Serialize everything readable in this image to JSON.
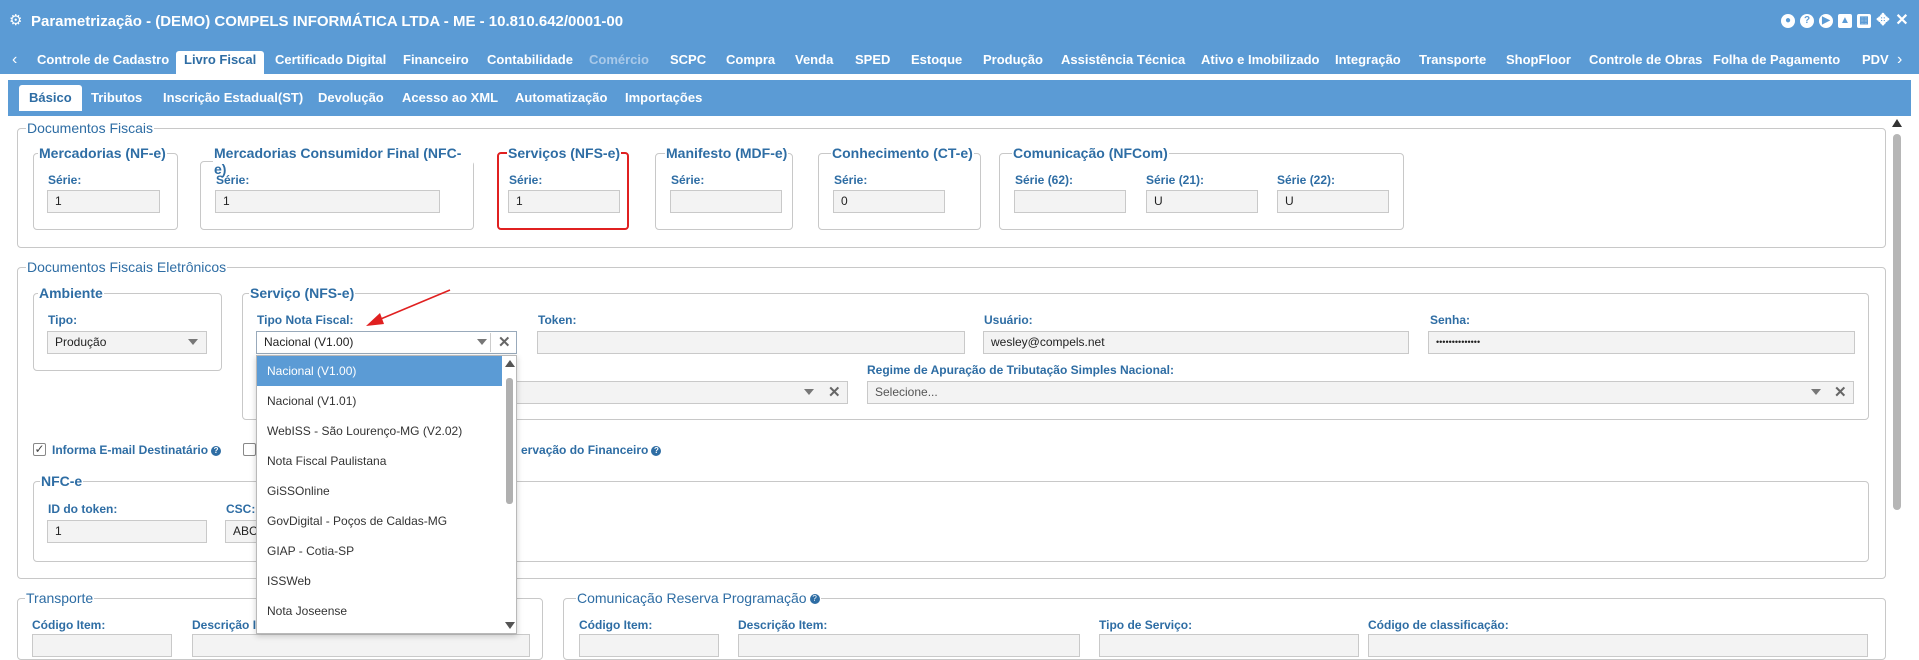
{
  "window": {
    "title": "Parametrização - (DEMO) COMPELS INFORMÁTICA LTDA - ME - 10.810.642/0001-00"
  },
  "main_tabs": [
    "Controle de Cadastro",
    "Livro Fiscal",
    "Certificado Digital",
    "Financeiro",
    "Contabilidade",
    "Comércio",
    "SCPC",
    "Compra",
    "Venda",
    "SPED",
    "Estoque",
    "Produção",
    "Assistência Técnica",
    "Ativo e Imobilizado",
    "Integração",
    "Transporte",
    "ShopFloor",
    "Controle de Obras",
    "Folha de Pagamento",
    "PDV"
  ],
  "sub_tabs": [
    "Básico",
    "Tributos",
    "Inscrição Estadual(ST)",
    "Devolução",
    "Acesso ao XML",
    "Automatização",
    "Importações"
  ],
  "docs_fiscais": {
    "legend": "Documentos Fiscais",
    "mercadorias": {
      "legend": "Mercadorias (NF-e)",
      "serie_label": "Série:",
      "serie": "1"
    },
    "consumidor": {
      "legend": "Mercadorias Consumidor Final (NFC-e)",
      "serie_label": "Série:",
      "serie": "1"
    },
    "servicos": {
      "legend": "Serviços (NFS-e)",
      "serie_label": "Série:",
      "serie": "1"
    },
    "manifesto": {
      "legend": "Manifesto (MDF-e)",
      "serie_label": "Série:",
      "serie": ""
    },
    "conhecimento": {
      "legend": "Conhecimento (CT-e)",
      "serie_label": "Série:",
      "serie": "0"
    },
    "comunicacao": {
      "legend": "Comunicação (NFCom)",
      "s62_label": "Série (62):",
      "s62": "",
      "s21_label": "Série (21):",
      "s21": "U",
      "s22_label": "Série (22):",
      "s22": "U"
    }
  },
  "docs_eletronicos": {
    "legend": "Documentos Fiscais Eletrônicos",
    "ambiente": {
      "legend": "Ambiente",
      "tipo_label": "Tipo:",
      "tipo": "Produção"
    },
    "servico": {
      "legend": "Serviço (NFS-e)",
      "tipo_nota_label": "Tipo Nota Fiscal:",
      "tipo_nota": "Nacional (V1.00)",
      "token_label": "Token:",
      "token": "",
      "usuario_label": "Usuário:",
      "usuario": "wesley@compels.net",
      "senha_label": "Senha:",
      "senha": "••••••••••••••",
      "regime_label": "Regime de Apuração de Tributação Simples Nacional:",
      "regime_placeholder": "Selecione..."
    },
    "informa_email": "Informa E-mail Destinatário",
    "observacao_fin": "ervação do Financeiro",
    "nfce": {
      "legend": "NFC-e",
      "id_token_label": "ID do token:",
      "id_token": "1",
      "csc_label": "CSC:",
      "csc": "ABC"
    }
  },
  "dropdown": {
    "options": [
      "Nacional (V1.00)",
      "Nacional (V1.01)",
      "WebISS - São Lourenço-MG (V2.02)",
      "Nota Fiscal Paulistana",
      "GiSSOnline",
      "GovDigital - Poços de Caldas-MG",
      "GIAP - Cotia-SP",
      "ISSWeb",
      "Nota Joseense"
    ],
    "selected": "Nacional (V1.00)"
  },
  "transporte": {
    "legend": "Transporte",
    "codigo_label": "Código Item:",
    "descricao_label": "Descrição I"
  },
  "reserva": {
    "legend": "Comunicação Reserva Programação",
    "codigo_label": "Código Item:",
    "descricao_label": "Descrição Item:",
    "tipo_servico_label": "Tipo de Serviço:",
    "classificacao_label": "Código de classificação:"
  },
  "colors": {
    "brand": "#5b9bd5",
    "label": "#2e6da4",
    "highlight": "#e02020",
    "arrow": "#e02020"
  }
}
